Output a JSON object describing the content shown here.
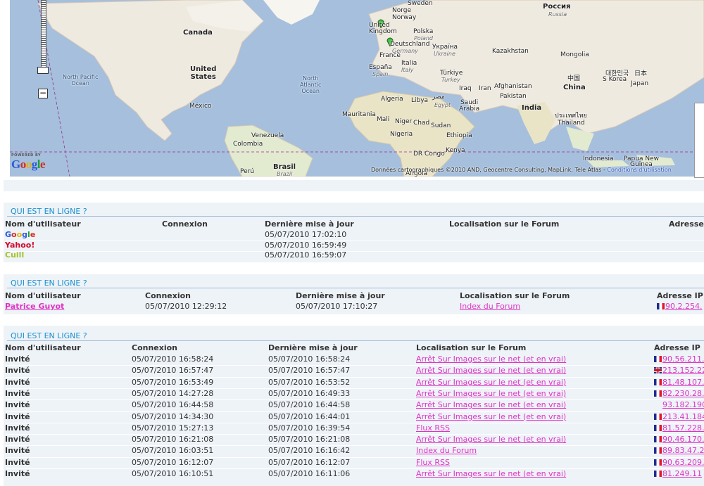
{
  "map": {
    "labels": {
      "sweden": "Sweden",
      "norway": "Norge\nNorway",
      "russia": "Россия",
      "russia_en": "Russia",
      "canada": "Canada",
      "united_states": "United\nStates",
      "north_pacific": "North Pacific\nOcean",
      "north_atlantic": "North\nAtlantic\nOcean",
      "mexico": "México",
      "venezuela": "Venezuela",
      "colombia": "Colombia",
      "brasil": "Brasil",
      "brazil": "Brazil",
      "peru": "Perú",
      "united_kingdom": "United\nKingdom",
      "polska": "Polska",
      "poland": "Poland",
      "deutschland": "Deutschland",
      "germany": "Germany",
      "france": "France",
      "ukraine": "Україна",
      "ukraine_en": "Ukraine",
      "espana": "España",
      "spain": "Spain",
      "italia": "Italia",
      "italy": "Italy",
      "turkiye": "Türkiye",
      "turkey": "Turkey",
      "kazakhstan": "Kazakhstan",
      "mongolia": "Mongolia",
      "iraq": "Iraq",
      "iran": "Iran",
      "afghanistan": "Afghanistan",
      "pakistan": "Pakistan",
      "algeria": "Algeria",
      "libya": "Libya",
      "egypt_ar": "مصر",
      "egypt": "Egypt",
      "saudi": "Saudi\nArabia",
      "india": "India",
      "china_zh": "中国",
      "china": "China",
      "s_korea_ko": "대한민국",
      "japan_ja": "日本",
      "s_korea": "S Korea",
      "japan": "Japan",
      "thailand_th": "ประเทศไทย",
      "thailand": "Thailand",
      "mauritania": "Mauritania",
      "mali": "Mali",
      "niger": "Niger",
      "chad": "Chad",
      "sudan": "Sudan",
      "nigeria": "Nigeria",
      "ethiopia": "Ethiopia",
      "dr_congo": "DR Congo",
      "kenya": "Kenya",
      "angola": "Angola",
      "indonesia": "Indonesia",
      "png": "Papua New\nGuinea"
    },
    "powered_by": "POWERED BY",
    "google_letters": [
      "G",
      "o",
      "o",
      "g",
      "l",
      "e"
    ],
    "copyright": "Données cartographiques ©2010 AND, Geocentre Consulting, MapLink, Tele Atlas - ",
    "terms_link": "Conditions d'utilisation",
    "zoom_out_label": "−"
  },
  "panel1": {
    "title": "QUI EST EN LIGNE ?",
    "headers": [
      "Nom d'utilisateur",
      "Connexion",
      "Dernière mise à jour",
      "Localisation sur le Forum",
      "Adresse"
    ],
    "rows": [
      {
        "user": "Google",
        "user_type": "google",
        "last_update": "05/07/2010 17:02:10"
      },
      {
        "user": "Yahoo!",
        "user_type": "yahoo",
        "last_update": "05/07/2010 16:59:49"
      },
      {
        "user": "Cuill",
        "user_type": "cuil",
        "last_update": "05/07/2010 16:59:07"
      }
    ]
  },
  "panel2": {
    "title": "QUI EST EN LIGNE ?",
    "headers": [
      "Nom d'utilisateur",
      "Connexion",
      "Dernière mise à jour",
      "Localisation sur le Forum",
      "Adresse IP"
    ],
    "rows": [
      {
        "user": "Patrice Guyot",
        "connexion": "05/07/2010 12:29:12",
        "last_update": "05/07/2010 17:10:27",
        "location": "Index du Forum",
        "flag": "fr",
        "ip": "90.2.254."
      }
    ]
  },
  "panel3": {
    "title": "QUI EST EN LIGNE ?",
    "headers": [
      "Nom d'utilisateur",
      "Connexion",
      "Dernière mise à jour",
      "Localisation sur le Forum",
      "Adresse IP"
    ],
    "rows": [
      {
        "user": "Invité",
        "connexion": "05/07/2010 16:58:24",
        "last_update": "05/07/2010 16:58:24",
        "location": "Arrêt Sur Images sur le net (et en vrai)",
        "flag": "fr",
        "ip": "90.56.211."
      },
      {
        "user": "Invité",
        "connexion": "05/07/2010 16:57:47",
        "last_update": "05/07/2010 16:57:47",
        "location": "Arrêt Sur Images sur le net (et en vrai)",
        "flag": "uk",
        "ip": "213.152.22"
      },
      {
        "user": "Invité",
        "connexion": "05/07/2010 16:53:49",
        "last_update": "05/07/2010 16:53:52",
        "location": "Arrêt Sur Images sur le net (et en vrai)",
        "flag": "fr",
        "ip": "81.48.107."
      },
      {
        "user": "Invité",
        "connexion": "05/07/2010 14:27:28",
        "last_update": "05/07/2010 16:49:33",
        "location": "Arrêt Sur Images sur le net (et en vrai)",
        "flag": "fr",
        "ip": "82.230.28."
      },
      {
        "user": "Invité",
        "connexion": "05/07/2010 16:44:58",
        "last_update": "05/07/2010 16:44:58",
        "location": "Arrêt Sur Images sur le net (et en vrai)",
        "flag": "",
        "ip": "93.182.190"
      },
      {
        "user": "Invité",
        "connexion": "05/07/2010 14:34:30",
        "last_update": "05/07/2010 16:44:01",
        "location": "Arrêt Sur Images sur le net (et en vrai)",
        "flag": "fr",
        "ip": "213.41.184"
      },
      {
        "user": "Invité",
        "connexion": "05/07/2010 15:27:13",
        "last_update": "05/07/2010 16:39:54",
        "location": "Flux RSS",
        "flag": "fr",
        "ip": "81.57.228."
      },
      {
        "user": "Invité",
        "connexion": "05/07/2010 16:21:08",
        "last_update": "05/07/2010 16:21:08",
        "location": "Arrêt Sur Images sur le net (et en vrai)",
        "flag": "fr",
        "ip": "90.46.170."
      },
      {
        "user": "Invité",
        "connexion": "05/07/2010 16:03:51",
        "last_update": "05/07/2010 16:16:42",
        "location": "Index du Forum",
        "flag": "fr",
        "ip": "89.83.47.2"
      },
      {
        "user": "Invité",
        "connexion": "05/07/2010 16:12:07",
        "last_update": "05/07/2010 16:12:07",
        "location": "Flux RSS",
        "flag": "fr",
        "ip": "90.63.209."
      },
      {
        "user": "Invité",
        "connexion": "05/07/2010 16:10:51",
        "last_update": "05/07/2010 16:11:06",
        "location": "Arrêt Sur Images sur le net (et en vrai)",
        "flag": "fr",
        "ip": "81.249.11"
      }
    ]
  }
}
